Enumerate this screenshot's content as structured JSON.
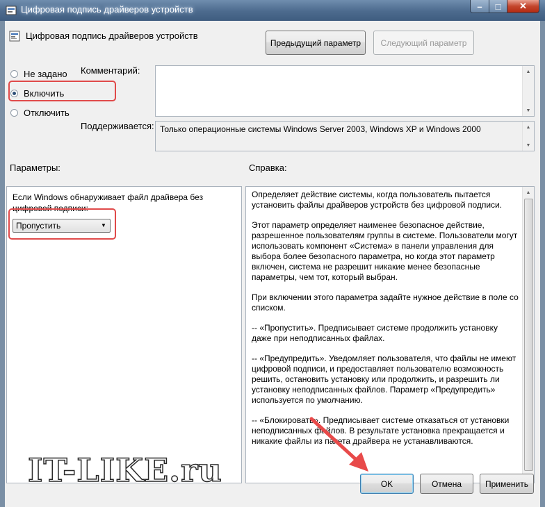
{
  "window": {
    "title": "Цифровая подпись драйверов устройств",
    "buttons": {
      "minimize": "–",
      "maximize": "□",
      "close": "✕"
    }
  },
  "header": {
    "setting_name": "Цифровая подпись драйверов устройств",
    "prev_button": "Предыдущий параметр",
    "next_button": "Следующий параметр"
  },
  "state": {
    "options": [
      "Не задано",
      "Включить",
      "Отключить"
    ],
    "selected": "Включить"
  },
  "comment_label": "Комментарий:",
  "supported": {
    "label": "Поддерживается:",
    "value": "Только операционные системы Windows Server 2003, Windows XP и Windows 2000"
  },
  "params": {
    "label": "Параметры:",
    "description_line1": "Если Windows обнаруживает файл драйвера без",
    "description_line2": "цифровой подписи:",
    "dropdown_value": "Пропустить"
  },
  "help": {
    "label": "Справка:",
    "paragraphs": [
      "Определяет действие системы, когда пользователь пытается установить файлы драйверов устройств без цифровой подписи.",
      "Этот параметр определяет наименее безопасное действие, разрешенное пользователям группы в системе. Пользователи могут использовать компонент «Система» в панели управления для выбора более безопасного параметра, но когда этот параметр включен, система не разрешит никакие менее безопасные параметры, чем тот, который выбран.",
      "При включении этого параметра задайте нужное действие в поле со списком.",
      "--   «Пропустить». Предписывает системе продолжить установку даже при неподписанных файлах.",
      "--   «Предупредить». Уведомляет пользователя, что файлы не имеют цифровой подписи, и предоставляет пользователю возможность решить, остановить установку или продолжить, и разрешить ли установку неподписанных файлов. Параметр «Предупредить» используется по умолчанию.",
      "--   «Блокировать». Предписывает системе отказаться от установки неподписанных файлов. В результате установка прекращается и никакие файлы из пакета драйвера не устанавливаются."
    ]
  },
  "footer": {
    "ok": "OK",
    "cancel": "Отмена",
    "apply": "Применить"
  },
  "watermark": "IT-LIKE.ru",
  "colors": {
    "highlight": "#e04a4a",
    "arrow": "#e84a4a",
    "title_bar": "#4c6a8d"
  }
}
